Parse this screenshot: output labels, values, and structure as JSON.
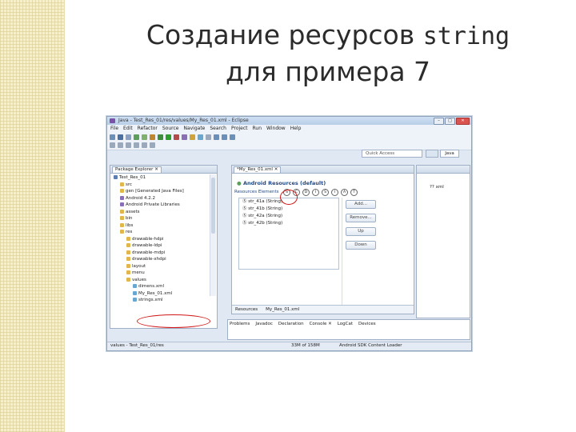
{
  "slide": {
    "title_line1_text": "Создание ресурсов",
    "title_line1_code": "string",
    "title_line2": "для примера 7"
  },
  "window": {
    "title": "Java - Test_Res_01/res/values/My_Res_01.xml - Eclipse",
    "min": "–",
    "max": "□",
    "close": "✕"
  },
  "menu": [
    "File",
    "Edit",
    "Refactor",
    "Source",
    "Navigate",
    "Search",
    "Project",
    "Run",
    "Window",
    "Help"
  ],
  "toolbar": {
    "quick_access": "Quick Access",
    "perspective_java": "Java"
  },
  "package_explorer": {
    "tab": "Package Explorer ✕",
    "tree": [
      {
        "label": "Test_Res_01",
        "indent": 0,
        "icon": "project-icon"
      },
      {
        "label": "src",
        "indent": 1,
        "icon": "folder-icon"
      },
      {
        "label": "gen [Generated Java Files]",
        "indent": 1,
        "icon": "folder-icon"
      },
      {
        "label": "Android 4.2.2",
        "indent": 1,
        "icon": "library-icon"
      },
      {
        "label": "Android Private Libraries",
        "indent": 1,
        "icon": "library-icon"
      },
      {
        "label": "assets",
        "indent": 1,
        "icon": "folder-icon"
      },
      {
        "label": "bin",
        "indent": 1,
        "icon": "folder-icon"
      },
      {
        "label": "libs",
        "indent": 1,
        "icon": "folder-icon"
      },
      {
        "label": "res",
        "indent": 1,
        "icon": "folder-icon"
      },
      {
        "label": "drawable-hdpi",
        "indent": 2,
        "icon": "folder-icon"
      },
      {
        "label": "drawable-ldpi",
        "indent": 2,
        "icon": "folder-icon"
      },
      {
        "label": "drawable-mdpi",
        "indent": 2,
        "icon": "folder-icon"
      },
      {
        "label": "drawable-xhdpi",
        "indent": 2,
        "icon": "folder-icon"
      },
      {
        "label": "layout",
        "indent": 2,
        "icon": "folder-icon"
      },
      {
        "label": "menu",
        "indent": 2,
        "icon": "folder-icon"
      },
      {
        "label": "values",
        "indent": 2,
        "icon": "folder-icon"
      },
      {
        "label": "dimens.xml",
        "indent": 3,
        "icon": "xml-file-icon"
      },
      {
        "label": "My_Res_01.xml",
        "indent": 3,
        "icon": "xml-file-icon"
      },
      {
        "label": "strings.xml",
        "indent": 3,
        "icon": "xml-file-icon"
      }
    ]
  },
  "editor": {
    "tab": "*My_Res_01.xml ✕",
    "header": "Android Resources (default)",
    "elements_label": "Resources Elements",
    "element_icons": [
      "S",
      "C",
      "D",
      "I",
      "S",
      "I",
      "A",
      "T"
    ],
    "list": [
      "str_41a (String)",
      "str_41b (String)",
      "str_42a (String)",
      "str_42b (String)"
    ],
    "buttons": [
      "Add...",
      "Remove...",
      "Up",
      "Down"
    ],
    "bottom_tabs": [
      "Resources",
      "My_Res_01.xml"
    ]
  },
  "outline": {
    "item": "?? xml"
  },
  "console": {
    "tabs": [
      "Problems",
      "Javadoc",
      "Declaration",
      "Console ✕",
      "LogCat",
      "Devices"
    ]
  },
  "status": {
    "left": "values - Test_Res_01/res",
    "mid": "33M of 158M",
    "right": "Android SDK Content Loader"
  },
  "colors": {
    "highlight_oval": "#d01818",
    "title_text": "#2b2b2b"
  }
}
